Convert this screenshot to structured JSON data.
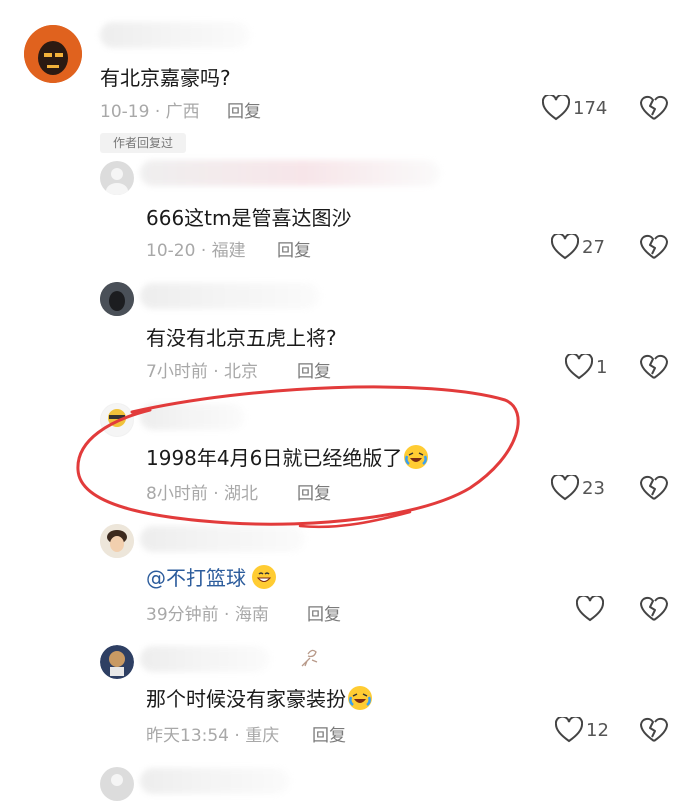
{
  "comments": [
    {
      "text": "有北京嘉豪吗?",
      "date": "10-19",
      "location": "广西",
      "reply_label": "回复",
      "likes": "174",
      "author_tag": "作者回复过"
    },
    {
      "text": "666这tm是管喜达图沙",
      "date": "10-20",
      "location": "福建",
      "reply_label": "回复",
      "likes": "27"
    },
    {
      "text": "有没有北京五虎上将?",
      "date": "7小时前",
      "location": "北京",
      "reply_label": "回复",
      "likes": "1"
    },
    {
      "text": "1998年4月6日就已经绝版了",
      "date": "8小时前",
      "location": "湖北",
      "reply_label": "回复",
      "likes": "23"
    },
    {
      "mention": "@不打篮球",
      "date": "39分钟前",
      "location": "海南",
      "reply_label": "回复",
      "likes": ""
    },
    {
      "text": "那个时候没有家豪装扮",
      "date": "昨天13:54",
      "location": "重庆",
      "reply_label": "回复",
      "likes": "12"
    }
  ],
  "separator": "·",
  "colors": {
    "annotation": "#e23b3b",
    "mention": "#2c5c9c"
  }
}
